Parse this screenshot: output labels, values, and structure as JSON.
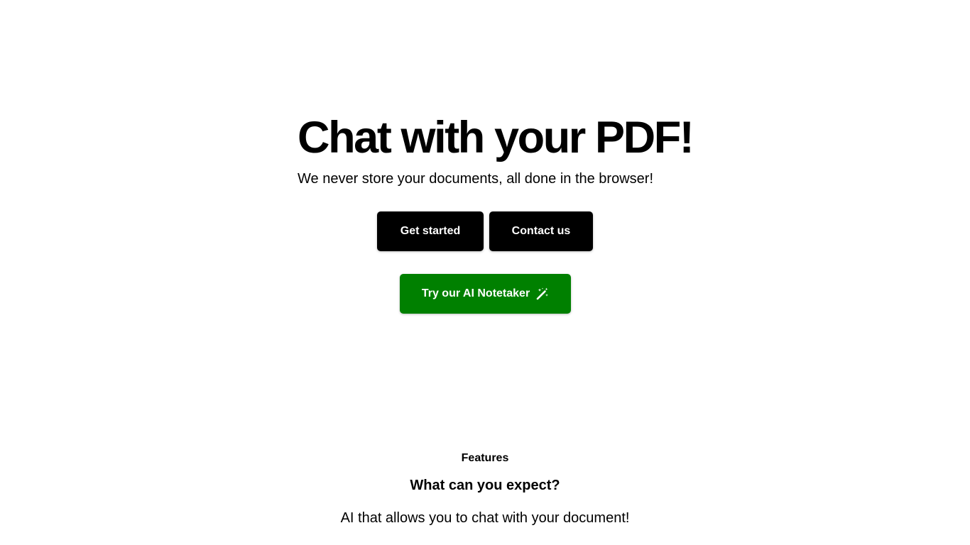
{
  "hero": {
    "title": "Chat with your PDF!",
    "subtitle": "We never store your documents, all done in the browser!"
  },
  "buttons": {
    "get_started_label": "Get started",
    "contact_label": "Contact us",
    "notetaker_label": "Try our AI Notetaker",
    "notetaker_icon": "magic-wand-icon"
  },
  "features": {
    "eyebrow": "Features",
    "heading": "What can you expect?",
    "description": "AI that allows you to chat with your document!"
  },
  "colors": {
    "primary_button": "#000000",
    "notetaker_button": "#008000",
    "background": "#ffffff",
    "text": "#000000"
  }
}
